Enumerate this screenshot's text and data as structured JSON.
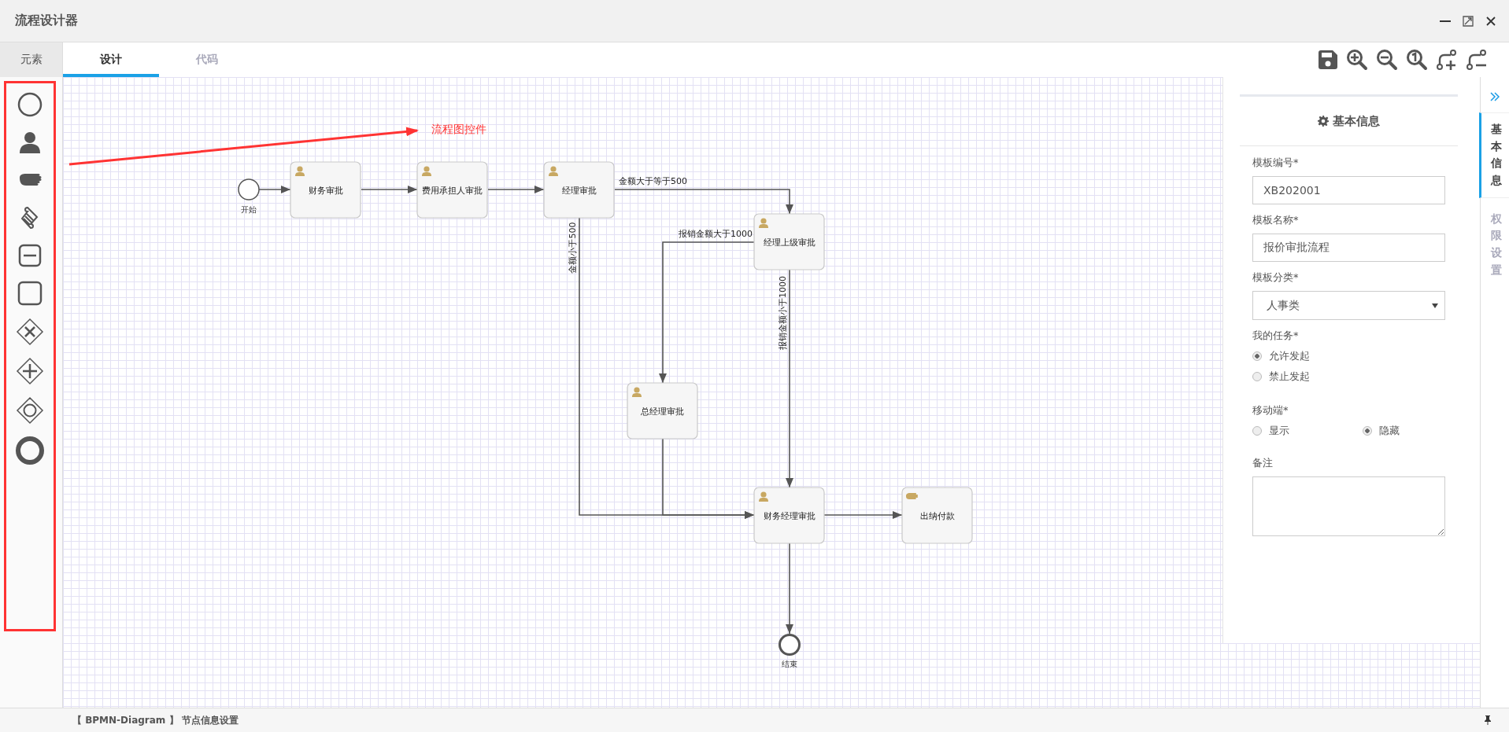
{
  "window": {
    "title": "流程设计器"
  },
  "palette": {
    "title": "元素"
  },
  "tabs": [
    {
      "label": "设计",
      "selected": true
    },
    {
      "label": "代码",
      "selected": false
    }
  ],
  "annotation": {
    "text": "流程图控件"
  },
  "diagram": {
    "start": {
      "label": "开始"
    },
    "end": {
      "label": "结束"
    },
    "tasks": [
      {
        "label": "财务审批",
        "kind": "user"
      },
      {
        "label": "费用承担人审批",
        "kind": "user"
      },
      {
        "label": "经理审批",
        "kind": "user"
      },
      {
        "label": "经理上级审批",
        "kind": "user"
      },
      {
        "label": "总经理审批",
        "kind": "user"
      },
      {
        "label": "财务经理审批",
        "kind": "user"
      },
      {
        "label": "出纳付款",
        "kind": "manual"
      }
    ],
    "conditions": [
      {
        "label": "金额大于等于500"
      },
      {
        "label": "金额小于500"
      },
      {
        "label": "报销金额大于1000"
      },
      {
        "label": "报销金额小于1000"
      }
    ]
  },
  "properties": {
    "title": "基本信息",
    "fields": [
      {
        "kind": "text",
        "label": "模板编号*",
        "value": "XB202001"
      },
      {
        "kind": "text",
        "label": "模板名称*",
        "value": "报价审批流程"
      },
      {
        "kind": "select",
        "label": "模板分类*",
        "value": "人事类"
      },
      {
        "kind": "radio-list",
        "label": "我的任务*",
        "options": [
          {
            "label": "允许发起",
            "selected": true
          },
          {
            "label": "禁止发起",
            "selected": false
          }
        ]
      },
      {
        "kind": "radio-row",
        "label": "移动端*",
        "options": [
          {
            "label": "显示",
            "selected": false
          },
          {
            "label": "隐藏",
            "selected": true
          }
        ]
      },
      {
        "kind": "textarea",
        "label": "备注"
      }
    ]
  },
  "side_tabs": [
    {
      "label": "基本信息",
      "selected": true
    },
    {
      "label": "权限设置",
      "selected": false
    }
  ],
  "status_bar": {
    "text": "【 BPMN-Diagram 】 节点信息设置"
  }
}
